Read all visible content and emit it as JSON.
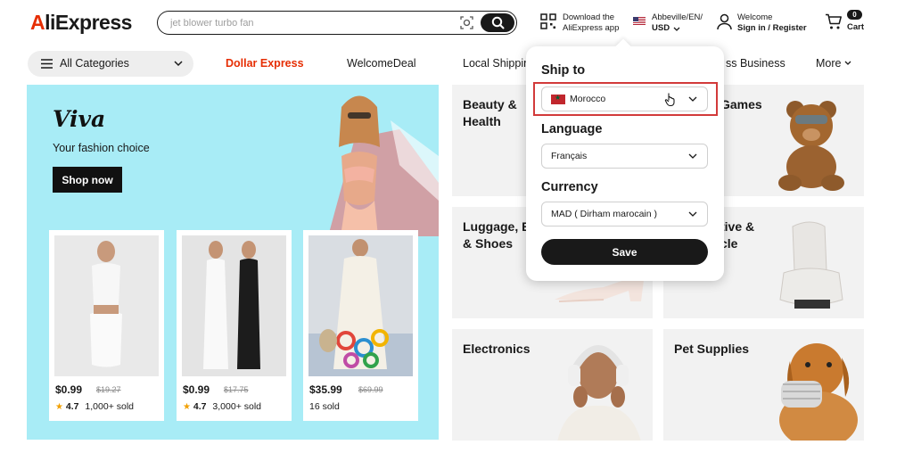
{
  "header": {
    "logo": "AliExpress",
    "search_placeholder": "jet blower turbo fan",
    "app_line1": "Download the",
    "app_line2": "AliExpress app",
    "locale_line1": "Abbeville/EN/",
    "locale_line2": "USD",
    "account_line1": "Welcome",
    "account_line2": "Sign in / Register",
    "cart_count": "0",
    "cart_label": "Cart"
  },
  "nav": {
    "all_categories": "All Categories",
    "links": [
      "Dollar Express",
      "WelcomeDeal",
      "Local Shippin",
      "ss Business",
      "More"
    ]
  },
  "hero": {
    "script_title": "Viva",
    "subtitle": "Your fashion choice",
    "cta": "Shop now",
    "products": [
      {
        "price": "$0.99",
        "old_price": "$19.27",
        "rating": "4.7",
        "sold": "1,000+ sold"
      },
      {
        "price": "$0.99",
        "old_price": "$17.75",
        "rating": "4.7",
        "sold": "3,000+ sold"
      },
      {
        "price": "$35.99",
        "old_price": "$69.99",
        "rating": "",
        "sold": "16 sold"
      }
    ]
  },
  "tiles": [
    {
      "title": "Beauty &\nHealth"
    },
    {
      "title": "Games"
    },
    {
      "title": "Luggage, E\n& Shoes"
    },
    {
      "title": "tive &\ncle"
    },
    {
      "title": "Electronics"
    },
    {
      "title": "Pet Supplies"
    }
  ],
  "popover": {
    "ship_to_heading": "Ship to",
    "ship_to_value": "Morocco",
    "language_heading": "Language",
    "language_value": "Français",
    "currency_heading": "Currency",
    "currency_value": "MAD ( Dirham marocain )",
    "save_label": "Save"
  },
  "colors": {
    "brand_red": "#e62e04",
    "hero_bg": "#a8ecf6",
    "highlight_border": "#d23a3a",
    "button_dark": "#191919"
  },
  "icons": [
    "camera-search-icon",
    "search-icon",
    "qr-code-icon",
    "us-flag-icon",
    "user-icon",
    "cart-icon",
    "menu-icon",
    "chevron-down-icon",
    "morocco-flag-icon",
    "hand-cursor-icon",
    "star-icon"
  ]
}
